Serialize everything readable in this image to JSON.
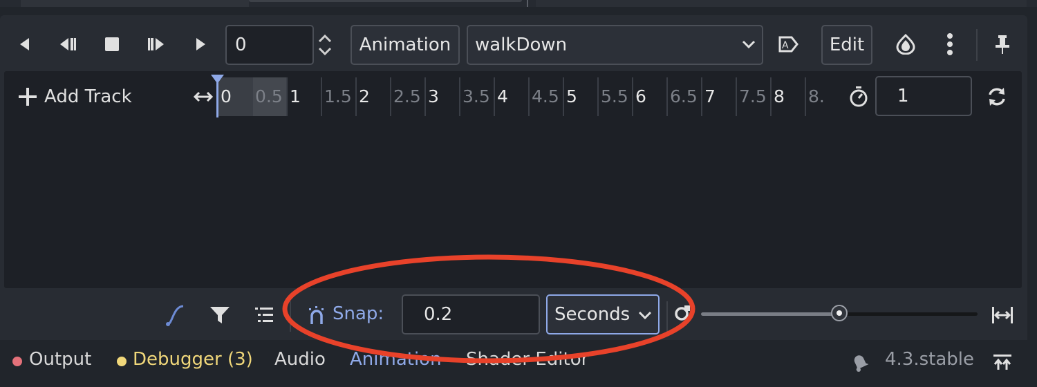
{
  "toolbar": {
    "time_value": "0",
    "animation_button": "Animation",
    "animation_selected": "walkDown",
    "edit_button": "Edit",
    "icons": [
      "play-backwards-icon",
      "step-backward-icon",
      "stop-icon",
      "step-forward-icon",
      "play-icon",
      "spin-arrows-icon",
      "autoplay-icon",
      "onion-skin-icon",
      "more-icon",
      "pin-icon"
    ]
  },
  "timeline": {
    "add_track": "Add Track",
    "ticks": [
      "0",
      "0.5",
      "1",
      "1.5",
      "2",
      "2.5",
      "3",
      "3.5",
      "4",
      "4.5",
      "5",
      "5.5",
      "6",
      "6.5",
      "7",
      "7.5",
      "8",
      "8."
    ],
    "length_value": "1"
  },
  "bottom_toolbar": {
    "snap_label": "Snap:",
    "snap_value": "0.2",
    "snap_unit": "Seconds",
    "zoom_fraction": 0.5
  },
  "bottom_tabs": {
    "output": "Output",
    "debugger": "Debugger (3)",
    "audio": "Audio",
    "animation": "Animation",
    "shader_editor": "Shader Editor",
    "version": "4.3.stable"
  },
  "colors": {
    "accent": "#8fa9e8",
    "output_dot": "#e4717a",
    "debugger": "#f0d77a",
    "highlight_ellipse": "#e8422a"
  }
}
